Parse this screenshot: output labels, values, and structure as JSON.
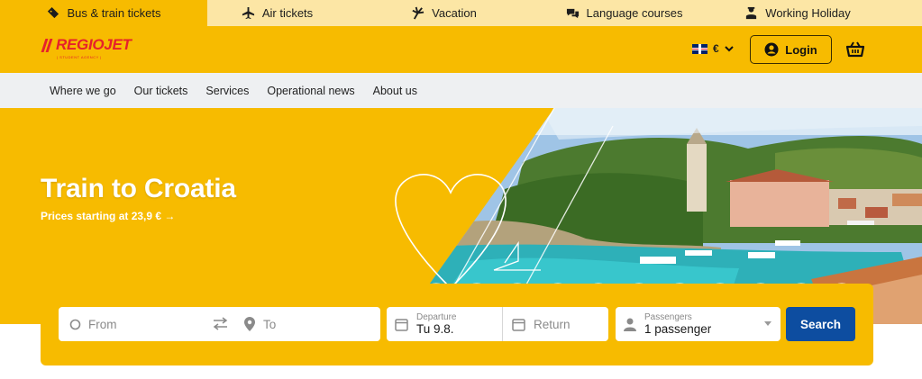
{
  "topnav": {
    "tabs": [
      {
        "label": "Bus & train tickets",
        "icon": "ticket-icon",
        "active": true
      },
      {
        "label": "Air tickets",
        "icon": "plane-icon",
        "active": false
      },
      {
        "label": "Vacation",
        "icon": "palm-icon",
        "active": false
      },
      {
        "label": "Language courses",
        "icon": "chat-bubbles-icon",
        "active": false
      },
      {
        "label": "Working Holiday",
        "icon": "worker-icon",
        "active": false
      }
    ]
  },
  "header": {
    "logo_text": "REGIOJET",
    "logo_tagline": "| STUDENT AGENCY |",
    "currency": "€",
    "login_label": "Login"
  },
  "subnav": {
    "items": [
      "Where we go",
      "Our tickets",
      "Services",
      "Operational news",
      "About us"
    ]
  },
  "hero": {
    "title": "Train to Croatia",
    "subtitle": "Prices starting at 23,9 € →"
  },
  "search": {
    "from_placeholder": "From",
    "to_placeholder": "To",
    "departure_label": "Departure",
    "departure_value": "Tu 9.8.",
    "return_placeholder": "Return",
    "passengers_label": "Passengers",
    "passengers_value": "1 passenger",
    "search_label": "Search"
  },
  "colors": {
    "brand_yellow": "#f7bb00",
    "brand_red": "#e6212b",
    "search_button": "#0d4da0"
  }
}
